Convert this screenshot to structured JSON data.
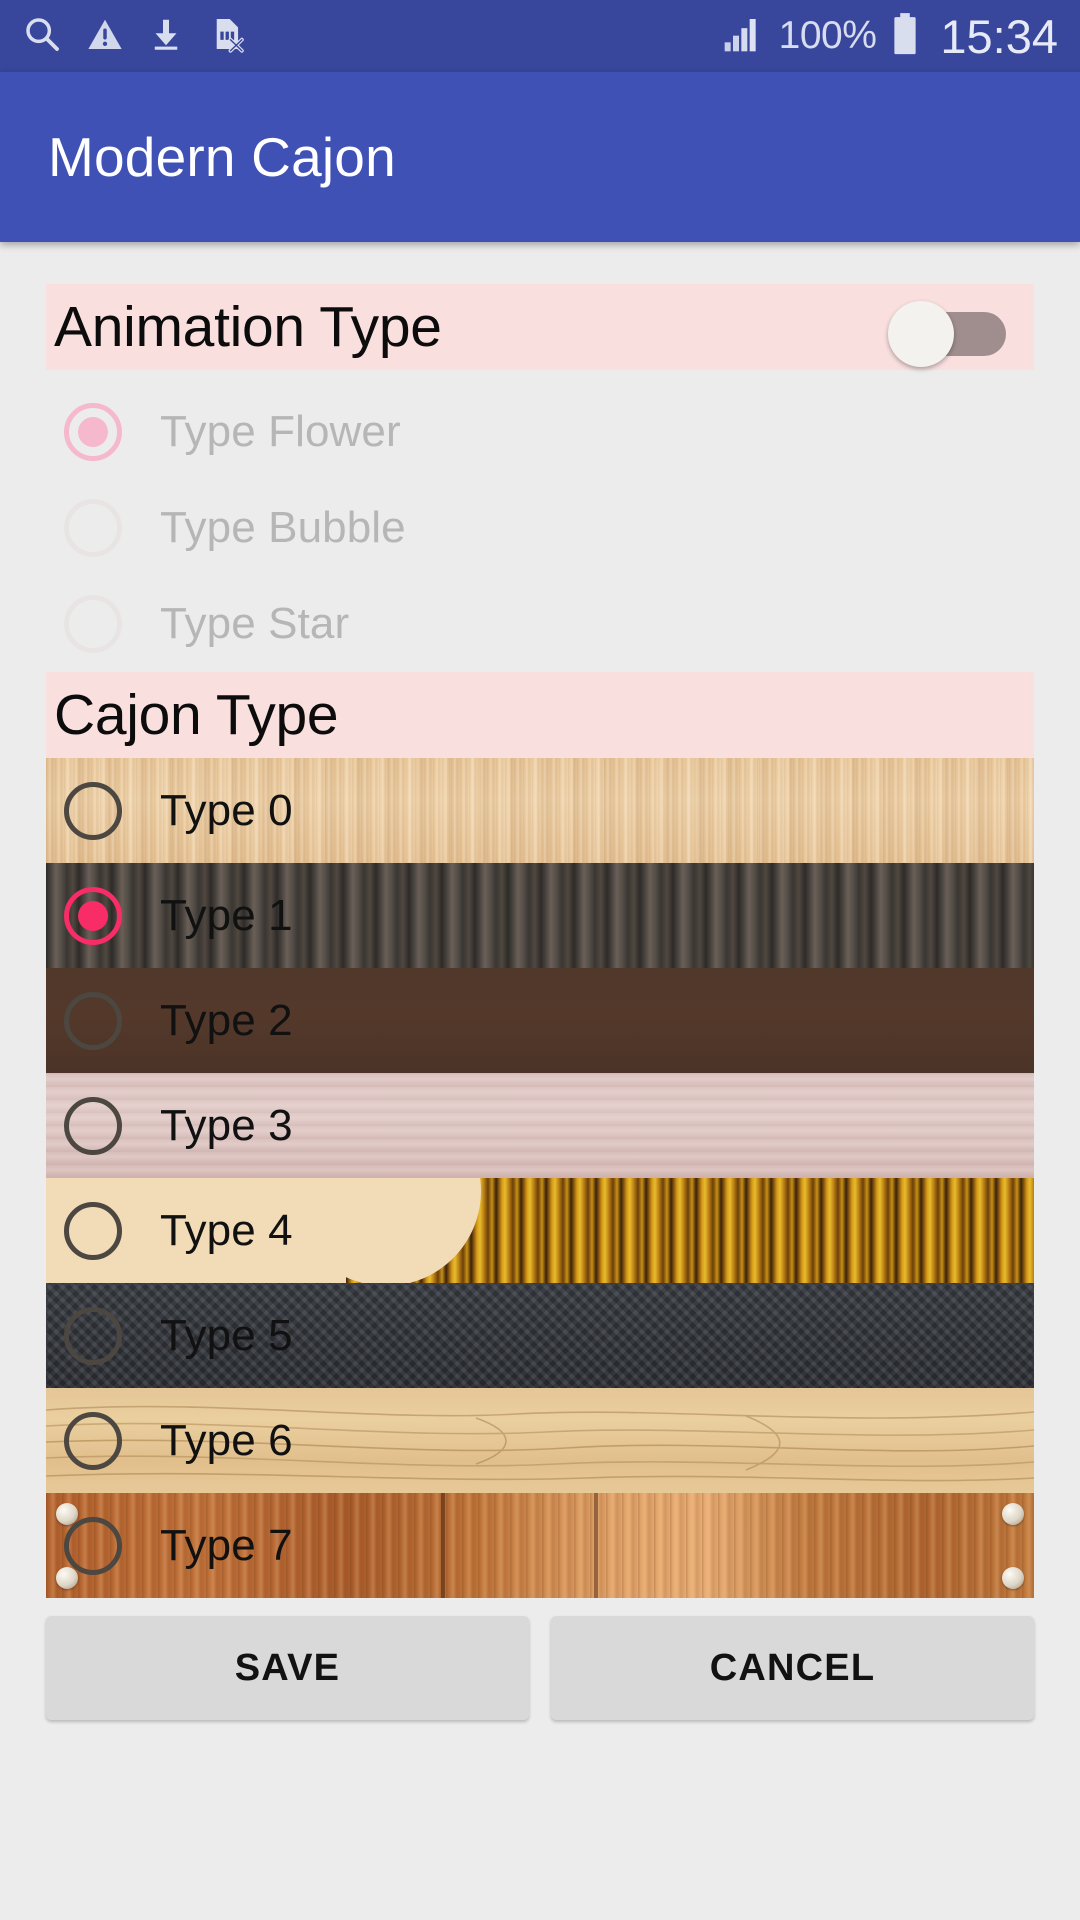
{
  "status_bar": {
    "background": "#38469b",
    "icons": [
      "search-icon",
      "warning-icon",
      "download-icon",
      "sim-card-error-icon",
      "signal-bars-icon",
      "battery-icon"
    ],
    "battery_percent": "100%",
    "clock": "15:34"
  },
  "app_bar": {
    "title": "Modern Cajon",
    "background": "#3f51b5"
  },
  "animation_section": {
    "header": "Animation Type",
    "header_background": "#fadfdf",
    "toggle": {
      "name": "animation-toggle",
      "state": "off"
    },
    "enabled": false,
    "selected_index": 0,
    "options": [
      {
        "label": "Type Flower",
        "selected": true
      },
      {
        "label": "Type Bubble",
        "selected": false
      },
      {
        "label": "Type Star",
        "selected": false
      }
    ]
  },
  "cajon_section": {
    "header": "Cajon Type",
    "header_background": "#fadfdf",
    "selected_index": 1,
    "accent_color": "#f82c66",
    "options": [
      {
        "label": "Type 0",
        "selected": false
      },
      {
        "label": "Type 1",
        "selected": true
      },
      {
        "label": "Type 2",
        "selected": false
      },
      {
        "label": "Type 3",
        "selected": false
      },
      {
        "label": "Type 4",
        "selected": false
      },
      {
        "label": "Type 5",
        "selected": false
      },
      {
        "label": "Type 6",
        "selected": false
      },
      {
        "label": "Type 7",
        "selected": false
      }
    ]
  },
  "buttons": {
    "save": "SAVE",
    "cancel": "CANCEL"
  }
}
